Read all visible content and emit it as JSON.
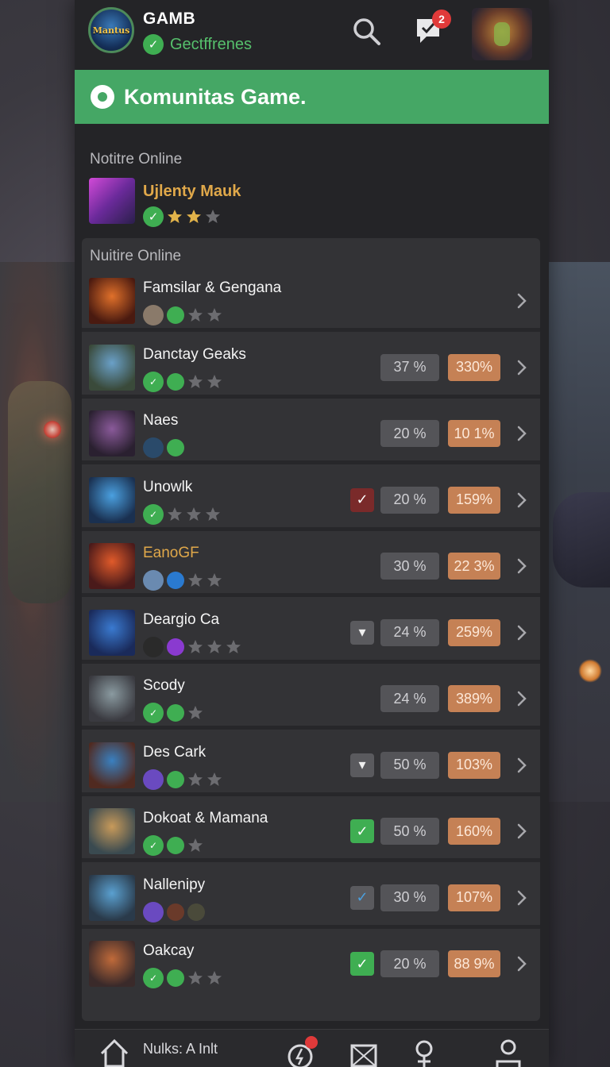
{
  "app": {
    "title": "GAMB",
    "status_label": "Gectffrenes",
    "notification_count": "2",
    "logo_text": "Mantus"
  },
  "banner": {
    "title": "Komunitas Game."
  },
  "featured": {
    "section_label": "Notitre Online",
    "item": {
      "name": "Ujlenty Mauk",
      "stars": 2,
      "max_stars": 3
    }
  },
  "list": {
    "section_label": "Nuitire Online",
    "rows": [
      {
        "name": "Famsilar & Gengana",
        "pct": "",
        "value": "",
        "mark": "none",
        "stars_empty": 2
      },
      {
        "name": "Danctay Geaks",
        "pct": "37 %",
        "value": "330%",
        "mark": "none",
        "stars_empty": 2
      },
      {
        "name": "Naes",
        "pct": "20 %",
        "value": "10 1%",
        "mark": "none",
        "stars_empty": 0
      },
      {
        "name": "Unowlk",
        "pct": "20 %",
        "value": "159%",
        "mark": "red-check",
        "stars_empty": 3
      },
      {
        "name": "EanoGF",
        "pct": "30 %",
        "value": "22 3%",
        "mark": "none",
        "stars_empty": 2
      },
      {
        "name": "Deargio Ca",
        "pct": "24 %",
        "value": "259%",
        "mark": "box",
        "stars_empty": 3
      },
      {
        "name": "Scody",
        "pct": "24 %",
        "value": "389%",
        "mark": "none",
        "stars_empty": 1
      },
      {
        "name": "Des Cark",
        "pct": "50 %",
        "value": "103%",
        "mark": "box",
        "stars_empty": 2
      },
      {
        "name": "Dokoat & Mamana",
        "pct": "50 %",
        "value": "160%",
        "mark": "green-check",
        "stars_empty": 1
      },
      {
        "name": "Nallenipy",
        "pct": "30 %",
        "value": "107%",
        "mark": "blue-check",
        "stars_empty": 0
      },
      {
        "name": "Oakcay",
        "pct": "20 %",
        "value": "88 9%",
        "mark": "green-check",
        "stars_empty": 2
      }
    ]
  },
  "bottom_nav": {
    "label": "Nulks: A Inlt",
    "items": [
      "home-icon",
      "activity-icon",
      "mail-icon",
      "profile-pin-icon",
      "user-icon"
    ]
  },
  "colors": {
    "accent_green": "#45a765",
    "value_orange": "#c58155",
    "panel": "#242427"
  }
}
